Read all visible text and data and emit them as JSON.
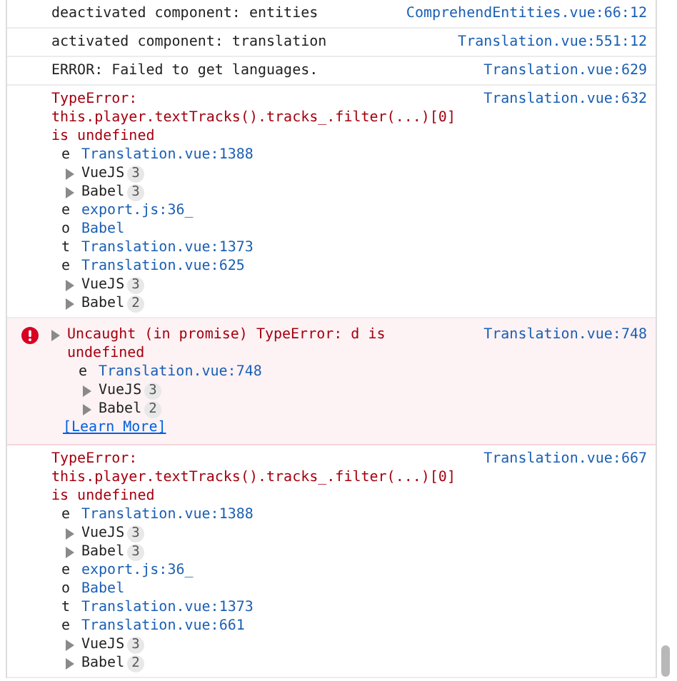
{
  "messages": [
    {
      "kind": "log",
      "text": "deactivated component: entities",
      "source": "ComprehendEntities.vue:66:12"
    },
    {
      "kind": "log",
      "text": "activated component: translation",
      "source": "Translation.vue:551:12"
    },
    {
      "kind": "log",
      "text": "ERROR: Failed to get languages.",
      "source": "Translation.vue:629"
    },
    {
      "kind": "error",
      "text": "TypeError: this.player.textTracks().tracks_.filter(...)[0] is undefined",
      "source": "Translation.vue:632",
      "stack": [
        {
          "kind": "frame",
          "fn": "e",
          "location": "Translation.vue:1388"
        },
        {
          "kind": "group",
          "name": "VueJS",
          "count": "3",
          "expanded": false
        },
        {
          "kind": "group",
          "name": "Babel",
          "count": "3",
          "expanded": false
        },
        {
          "kind": "frame",
          "fn": "e",
          "location": "export.js:36_"
        },
        {
          "kind": "frame",
          "fn": "o",
          "location": "Babel"
        },
        {
          "kind": "frame",
          "fn": "t",
          "location": "Translation.vue:1373"
        },
        {
          "kind": "frame",
          "fn": "e",
          "location": "Translation.vue:625"
        },
        {
          "kind": "group",
          "name": "VueJS",
          "count": "3",
          "expanded": false
        },
        {
          "kind": "group",
          "name": "Babel",
          "count": "2",
          "expanded": false
        }
      ]
    },
    {
      "kind": "uncaught",
      "text": "Uncaught (in promise) TypeError: d is undefined",
      "source": "Translation.vue:748",
      "learn_more": "[Learn More]",
      "stack": [
        {
          "kind": "frame",
          "fn": "e",
          "location": "Translation.vue:748"
        },
        {
          "kind": "group",
          "name": "VueJS",
          "count": "3",
          "expanded": false
        },
        {
          "kind": "group",
          "name": "Babel",
          "count": "2",
          "expanded": false
        }
      ]
    },
    {
      "kind": "error",
      "text": "TypeError: this.player.textTracks().tracks_.filter(...)[0] is undefined",
      "source": "Translation.vue:667",
      "stack": [
        {
          "kind": "frame",
          "fn": "e",
          "location": "Translation.vue:1388"
        },
        {
          "kind": "group",
          "name": "VueJS",
          "count": "3",
          "expanded": false
        },
        {
          "kind": "group",
          "name": "Babel",
          "count": "3",
          "expanded": false
        },
        {
          "kind": "frame",
          "fn": "e",
          "location": "export.js:36_"
        },
        {
          "kind": "frame",
          "fn": "o",
          "location": "Babel"
        },
        {
          "kind": "frame",
          "fn": "t",
          "location": "Translation.vue:1373"
        },
        {
          "kind": "frame",
          "fn": "e",
          "location": "Translation.vue:661"
        },
        {
          "kind": "group",
          "name": "VueJS",
          "count": "3",
          "expanded": false
        },
        {
          "kind": "group",
          "name": "Babel",
          "count": "2",
          "expanded": false
        }
      ]
    }
  ]
}
